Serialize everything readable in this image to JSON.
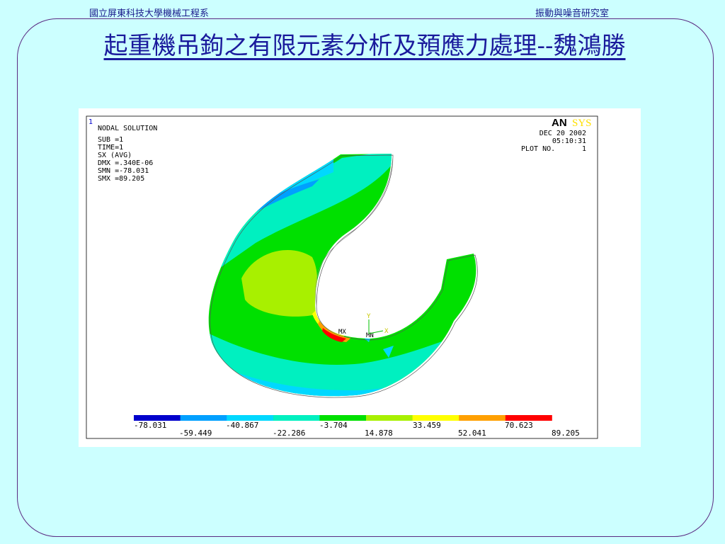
{
  "header": {
    "left": "國立屏東科技大學機械工程系",
    "right": "振動與噪音研究室"
  },
  "slide": {
    "title": "起重機吊鉤之有限元素分析及預應力處理--魏鴻勝"
  },
  "ansys": {
    "window_number": "1",
    "logo_an": "AN",
    "logo_sys": "SYS",
    "info": [
      "NODAL SOLUTION",
      "SUB =1",
      "TIME=1",
      "SX        (AVG)",
      "DMX =.340E-06",
      "SMN =-78.031",
      "SMX =89.205"
    ],
    "date": "DEC 20 2002",
    "time": "05:10:31",
    "plot_no_label": "PLOT NO.",
    "plot_no": "1",
    "mx_label": "MX",
    "mn_label": "MN",
    "axis_y": "Y",
    "axis_x": "X"
  },
  "legend": {
    "colors": [
      "#0000cc",
      "#00a0ff",
      "#00d8ff",
      "#00f0c0",
      "#00e000",
      "#a8f000",
      "#ffff00",
      "#ffa000",
      "#ff0000"
    ],
    "upper_labels": [
      "-78.031",
      "-40.867",
      "-3.704",
      "33.459",
      "70.623"
    ],
    "lower_labels": [
      "-59.449",
      "-22.286",
      "14.878",
      "52.041",
      "89.205"
    ]
  }
}
